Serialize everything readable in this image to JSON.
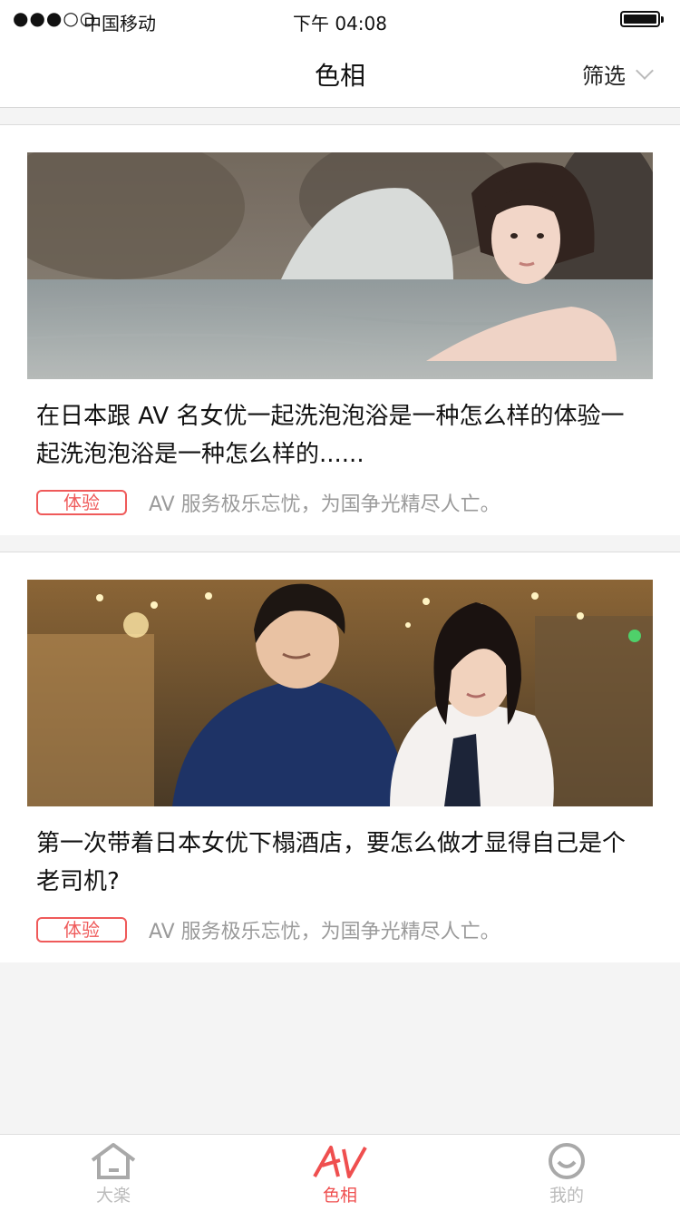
{
  "status_bar": {
    "signal": "●●●○○",
    "carrier": "中国移动",
    "time": "下午 04:08",
    "battery_icon": "battery-icon"
  },
  "nav": {
    "title": "色相",
    "filter_label": "筛选",
    "filter_icon": "chevron-down-icon"
  },
  "feed": {
    "cards": [
      {
        "title": "在日本跟 AV 名女优一起洗泡泡浴是一种怎么样的体验一起洗泡泡浴是一种怎么样的......",
        "tag": "体验",
        "description": "AV 服务极乐忘忧，为国争光精尽人亡。",
        "image": "woman-in-hot-spring-photo"
      },
      {
        "title": "第一次带着日本女优下榻酒店，要怎么做才显得自己是个老司机?",
        "tag": "体验",
        "description": "AV 服务极乐忘忧，为国争光精尽人亡。",
        "image": "couple-in-hotel-lobby-photo"
      }
    ]
  },
  "tabbar": {
    "tabs": [
      {
        "label": "大楽",
        "icon": "home-icon",
        "active": false
      },
      {
        "label": "色相",
        "icon": "av-logo-icon",
        "active": true
      },
      {
        "label": "我的",
        "icon": "smiley-profile-icon",
        "active": false
      }
    ]
  },
  "colors": {
    "accent": "#ef4f4f",
    "tag": "#ef5a5a",
    "background": "#f4f4f4",
    "muted_text": "#9a9a9a"
  }
}
